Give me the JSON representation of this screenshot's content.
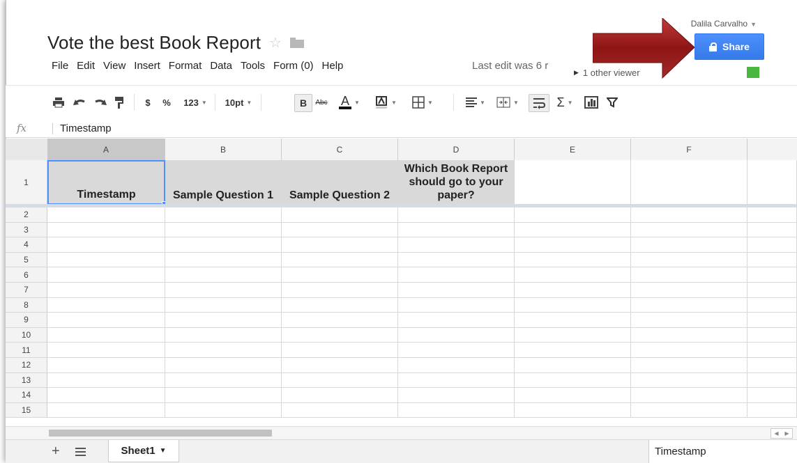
{
  "document": {
    "title": "Vote the best Book Report",
    "last_edit": "Last edit was 6 r",
    "viewers": "1 other viewer"
  },
  "user": {
    "name": "Dalila Carvalho"
  },
  "share": {
    "label": "Share"
  },
  "menu": [
    "File",
    "Edit",
    "View",
    "Insert",
    "Format",
    "Data",
    "Tools",
    "Form (0)",
    "Help"
  ],
  "toolbar": {
    "currency": "$",
    "percent": "%",
    "number_format": "123",
    "font_size": "10pt",
    "bold": "B",
    "strike": "Abc",
    "text_color": "A"
  },
  "formula_bar": {
    "fx": "fx",
    "value": "Timestamp"
  },
  "columns": [
    "A",
    "B",
    "C",
    "D",
    "E",
    "F"
  ],
  "rows": [
    "1",
    "2",
    "3",
    "4",
    "5",
    "6",
    "7",
    "8",
    "9",
    "10",
    "11",
    "12",
    "13",
    "14",
    "15"
  ],
  "header_cells": {
    "A": "Timestamp",
    "B": "Sample Question 1",
    "C": "Sample Question 2",
    "D": "Which Book Report should go to your paper?"
  },
  "sheets": {
    "active": "Sheet1"
  },
  "status": {
    "value": "Timestamp"
  },
  "colors": {
    "share_blue": "#4d90fe",
    "arrow_red": "#9e1c1c",
    "presence_green": "#4ab741"
  }
}
